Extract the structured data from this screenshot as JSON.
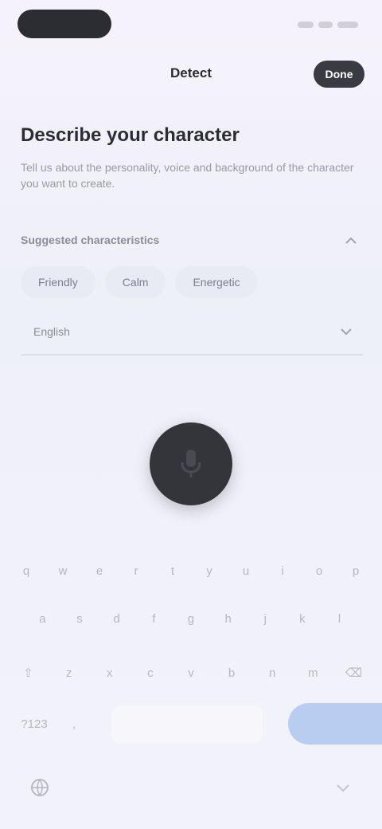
{
  "status_bar": {},
  "header": {
    "title": "Detect",
    "action_label": "Done"
  },
  "main": {
    "title": "Describe your character",
    "description": "Tell us about the personality, voice and background of the character you want to create.",
    "suggested_label": "Suggested characteristics",
    "chips": [
      "Friendly",
      "Calm",
      "Energetic"
    ],
    "language_label": "English"
  },
  "keyboard": {
    "row1": [
      "q",
      "w",
      "e",
      "r",
      "t",
      "y",
      "u",
      "i",
      "o",
      "p"
    ],
    "row2": [
      "a",
      "s",
      "d",
      "f",
      "g",
      "h",
      "j",
      "k",
      "l"
    ],
    "row3": [
      "⇧",
      "z",
      "x",
      "c",
      "v",
      "b",
      "n",
      "m",
      "⌫"
    ],
    "row4_left": [
      "?123",
      ","
    ],
    "enter_label": "",
    "icons": {
      "globe": "globe-icon",
      "hide": "keyboard-hide-icon",
      "mic": "microphone-icon"
    }
  },
  "colors": {
    "accent_dark": "#34343b",
    "enter_key": "#b9cdf0"
  }
}
